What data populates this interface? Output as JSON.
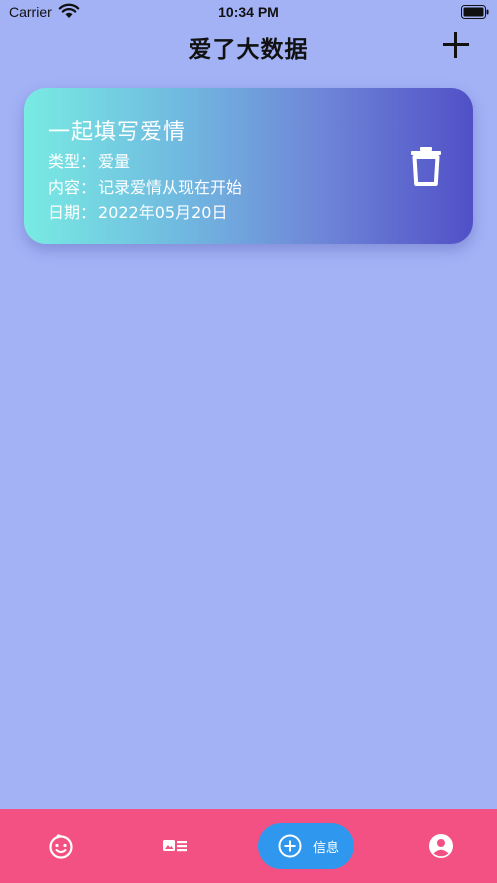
{
  "status_bar": {
    "carrier": "Carrier",
    "time": "10:34 PM"
  },
  "nav": {
    "title": "爱了大数据"
  },
  "card": {
    "title": "一起填写爱情",
    "type_label": "类型：",
    "type_value": "爱量",
    "content_label": "内容：",
    "content_value": "记录爱情从现在开始",
    "date_label": "日期：",
    "date_value": "2022年05月20日"
  },
  "tab_bar": {
    "tabs": [
      {
        "icon": "baby-face-icon"
      },
      {
        "icon": "id-card-icon"
      },
      {
        "icon": "add-circle-icon",
        "label": "信息",
        "active": true
      },
      {
        "icon": "user-profile-icon"
      }
    ]
  },
  "colors": {
    "background": "#a3b1f5",
    "card_gradient_start": "#78ebe2",
    "card_gradient_end": "#5150c7",
    "tab_bar": "#f35084",
    "active_tab": "#2f98ee"
  }
}
